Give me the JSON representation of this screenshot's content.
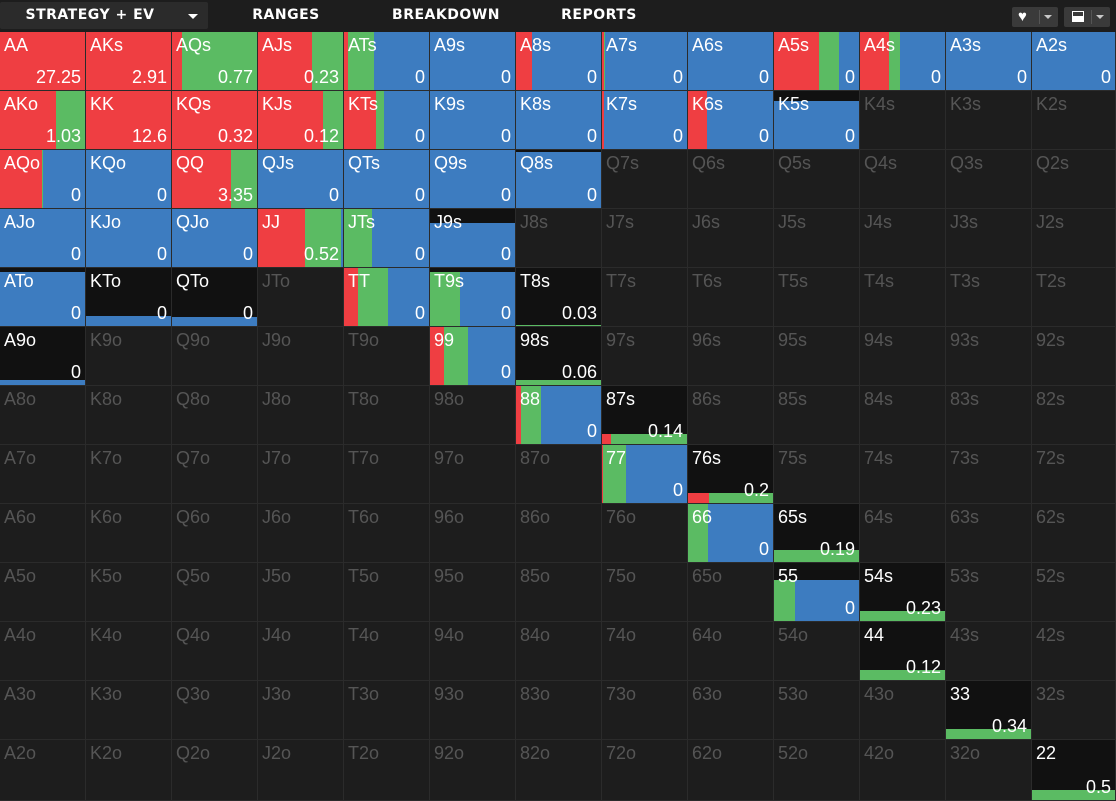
{
  "tabs": [
    {
      "label": "STRATEGY + EV",
      "active": true
    },
    {
      "label": "RANGES",
      "active": false
    },
    {
      "label": "BREAKDOWN",
      "active": false
    },
    {
      "label": "REPORTS",
      "active": false
    }
  ],
  "toolbar": {
    "heart_icon": "heart-icon",
    "layout_icon": "layout-icon"
  },
  "colors": {
    "raise": "#ef3e42",
    "call": "#5bbb63",
    "fold": "#3d7cc0",
    "background": "#1d1d1d",
    "inactive_text": "#555555"
  },
  "grid_hands": [
    [
      "AA",
      "AKs",
      "AQs",
      "AJs",
      "ATs",
      "A9s",
      "A8s",
      "A7s",
      "A6s",
      "A5s",
      "A4s",
      "A3s",
      "A2s"
    ],
    [
      "AKo",
      "KK",
      "KQs",
      "KJs",
      "KTs",
      "K9s",
      "K8s",
      "K7s",
      "K6s",
      "K5s",
      "K4s",
      "K3s",
      "K2s"
    ],
    [
      "AQo",
      "KQo",
      "QQ",
      "QJs",
      "QTs",
      "Q9s",
      "Q8s",
      "Q7s",
      "Q6s",
      "Q5s",
      "Q4s",
      "Q3s",
      "Q2s"
    ],
    [
      "AJo",
      "KJo",
      "QJo",
      "JJ",
      "JTs",
      "J9s",
      "J8s",
      "J7s",
      "J6s",
      "J5s",
      "J4s",
      "J3s",
      "J2s"
    ],
    [
      "ATo",
      "KTo",
      "QTo",
      "JTo",
      "TT",
      "T9s",
      "T8s",
      "T7s",
      "T6s",
      "T5s",
      "T4s",
      "T3s",
      "T2s"
    ],
    [
      "A9o",
      "K9o",
      "Q9o",
      "J9o",
      "T9o",
      "99",
      "98s",
      "97s",
      "96s",
      "95s",
      "94s",
      "93s",
      "92s"
    ],
    [
      "A8o",
      "K8o",
      "Q8o",
      "J8o",
      "T8o",
      "98o",
      "88",
      "87s",
      "86s",
      "85s",
      "84s",
      "83s",
      "82s"
    ],
    [
      "A7o",
      "K7o",
      "Q7o",
      "J7o",
      "T7o",
      "97o",
      "87o",
      "77",
      "76s",
      "75s",
      "74s",
      "73s",
      "72s"
    ],
    [
      "A6o",
      "K6o",
      "Q6o",
      "J6o",
      "T6o",
      "96o",
      "86o",
      "76o",
      "66",
      "65s",
      "64s",
      "63s",
      "62s"
    ],
    [
      "A5o",
      "K5o",
      "Q5o",
      "J5o",
      "T5o",
      "95o",
      "85o",
      "75o",
      "65o",
      "55",
      "54s",
      "53s",
      "52s"
    ],
    [
      "A4o",
      "K4o",
      "Q4o",
      "J4o",
      "T4o",
      "94o",
      "84o",
      "74o",
      "64o",
      "54o",
      "44",
      "43s",
      "42s"
    ],
    [
      "A3o",
      "K3o",
      "Q3o",
      "J3o",
      "T3o",
      "93o",
      "83o",
      "73o",
      "63o",
      "53o",
      "43o",
      "33",
      "32s"
    ],
    [
      "A2o",
      "K2o",
      "Q2o",
      "J2o",
      "T2o",
      "92o",
      "82o",
      "72o",
      "62o",
      "52o",
      "42o",
      "32o",
      "22"
    ]
  ],
  "active_hands": {
    "AA": {
      "ev": "27.25",
      "weight": 1,
      "raise": 1,
      "call": 0,
      "fold": 0
    },
    "AKs": {
      "ev": "2.91",
      "weight": 1,
      "raise": 1,
      "call": 0,
      "fold": 0
    },
    "AQs": {
      "ev": "0.77",
      "weight": 1,
      "raise": 0.12,
      "call": 0.88,
      "fold": 0
    },
    "AJs": {
      "ev": "0.23",
      "weight": 1,
      "raise": 0.64,
      "call": 0.36,
      "fold": 0
    },
    "ATs": {
      "ev": "0",
      "weight": 1,
      "raise": 0.05,
      "call": 0.3,
      "fold": 0.65
    },
    "A9s": {
      "ev": "0",
      "weight": 1,
      "raise": 0,
      "call": 0,
      "fold": 1
    },
    "A8s": {
      "ev": "0",
      "weight": 1,
      "raise": 0.19,
      "call": 0,
      "fold": 0.81
    },
    "A7s": {
      "ev": "0",
      "weight": 1,
      "raise": 0.02,
      "call": 0.02,
      "fold": 0.96
    },
    "A6s": {
      "ev": "0",
      "weight": 1,
      "raise": 0,
      "call": 0,
      "fold": 1
    },
    "A5s": {
      "ev": "0",
      "weight": 1,
      "raise": 0.53,
      "call": 0.23,
      "fold": 0.24
    },
    "A4s": {
      "ev": "0",
      "weight": 1,
      "raise": 0.34,
      "call": 0.13,
      "fold": 0.53
    },
    "A3s": {
      "ev": "0",
      "weight": 1,
      "raise": 0,
      "call": 0,
      "fold": 1
    },
    "A2s": {
      "ev": "0",
      "weight": 1,
      "raise": 0,
      "call": 0,
      "fold": 1
    },
    "AKo": {
      "ev": "1.03",
      "weight": 1,
      "raise": 0.66,
      "call": 0.34,
      "fold": 0
    },
    "KK": {
      "ev": "12.6",
      "weight": 1,
      "raise": 1,
      "call": 0,
      "fold": 0
    },
    "KQs": {
      "ev": "0.32",
      "weight": 1,
      "raise": 1,
      "call": 0,
      "fold": 0
    },
    "KJs": {
      "ev": "0.12",
      "weight": 1,
      "raise": 0.76,
      "call": 0.24,
      "fold": 0
    },
    "KTs": {
      "ev": "0",
      "weight": 1,
      "raise": 0.38,
      "call": 0.09,
      "fold": 0.53
    },
    "K9s": {
      "ev": "0",
      "weight": 1,
      "raise": 0,
      "call": 0,
      "fold": 1
    },
    "K8s": {
      "ev": "0",
      "weight": 1,
      "raise": 0,
      "call": 0,
      "fold": 1
    },
    "K7s": {
      "ev": "0",
      "weight": 1,
      "raise": 0.02,
      "call": 0,
      "fold": 0.98
    },
    "K6s": {
      "ev": "0",
      "weight": 1,
      "raise": 0.22,
      "call": 0,
      "fold": 0.78
    },
    "K5s": {
      "ev": "0",
      "weight": 0.82,
      "raise": 0,
      "call": 0,
      "fold": 1
    },
    "AQo": {
      "ev": "0",
      "weight": 1,
      "raise": 0.49,
      "call": 0.02,
      "fold": 0.49
    },
    "KQo": {
      "ev": "0",
      "weight": 1,
      "raise": 0,
      "call": 0,
      "fold": 1
    },
    "QQ": {
      "ev": "3.35",
      "weight": 1,
      "raise": 0.69,
      "call": 0.31,
      "fold": 0
    },
    "QJs": {
      "ev": "0",
      "weight": 1,
      "raise": 0,
      "call": 0,
      "fold": 1
    },
    "QTs": {
      "ev": "0",
      "weight": 1,
      "raise": 0,
      "call": 0,
      "fold": 1
    },
    "Q9s": {
      "ev": "0",
      "weight": 1,
      "raise": 0,
      "call": 0,
      "fold": 1
    },
    "Q8s": {
      "ev": "0",
      "weight": 0.97,
      "raise": 0,
      "call": 0,
      "fold": 1
    },
    "AJo": {
      "ev": "0",
      "weight": 1,
      "raise": 0,
      "call": 0,
      "fold": 1
    },
    "KJo": {
      "ev": "0",
      "weight": 1,
      "raise": 0,
      "call": 0,
      "fold": 1
    },
    "QJo": {
      "ev": "0",
      "weight": 1,
      "raise": 0,
      "call": 0,
      "fold": 1
    },
    "JJ": {
      "ev": "0.52",
      "weight": 1,
      "raise": 0.55,
      "call": 0.43,
      "fold": 0.02
    },
    "JTs": {
      "ev": "0",
      "weight": 1,
      "raise": 0,
      "call": 0.33,
      "fold": 0.67
    },
    "J9s": {
      "ev": "0",
      "weight": 0.76,
      "raise": 0,
      "call": 0,
      "fold": 1
    },
    "ATo": {
      "ev": "0",
      "weight": 0.93,
      "raise": 0,
      "call": 0,
      "fold": 1
    },
    "KTo": {
      "ev": "0",
      "weight": 0.17,
      "raise": 0,
      "call": 0,
      "fold": 1
    },
    "QTo": {
      "ev": "0",
      "weight": 0.16,
      "raise": 0,
      "call": 0,
      "fold": 1
    },
    "TT": {
      "ev": "0",
      "weight": 1,
      "raise": 0.17,
      "call": 0.35,
      "fold": 0.48
    },
    "T9s": {
      "ev": "0",
      "weight": 0.93,
      "raise": 0,
      "call": 0.35,
      "fold": 0.65
    },
    "T8s": {
      "ev": "0.03",
      "weight": 0.02,
      "raise": 0,
      "call": 1,
      "fold": 0
    },
    "A9o": {
      "ev": "0",
      "weight": 0.09,
      "raise": 0,
      "call": 0,
      "fold": 1
    },
    "99": {
      "ev": "0",
      "weight": 1,
      "raise": 0.16,
      "call": 0.29,
      "fold": 0.55
    },
    "98s": {
      "ev": "0.06",
      "weight": 0.09,
      "raise": 0,
      "call": 1,
      "fold": 0
    },
    "88": {
      "ev": "0",
      "weight": 1,
      "raise": 0.06,
      "call": 0.24,
      "fold": 0.7
    },
    "87s": {
      "ev": "0.14",
      "weight": 0.17,
      "raise": 0.1,
      "call": 0.9,
      "fold": 0
    },
    "77": {
      "ev": "0",
      "weight": 1,
      "raise": 0.01,
      "call": 0.27,
      "fold": 0.72
    },
    "76s": {
      "ev": "0.2",
      "weight": 0.17,
      "raise": 0.25,
      "call": 0.75,
      "fold": 0
    },
    "66": {
      "ev": "0",
      "weight": 1,
      "raise": 0,
      "call": 0.23,
      "fold": 0.77
    },
    "65s": {
      "ev": "0.19",
      "weight": 0.2,
      "raise": 0,
      "call": 1,
      "fold": 0
    },
    "55": {
      "ev": "0",
      "weight": 0.7,
      "raise": 0,
      "call": 0.25,
      "fold": 0.75
    },
    "54s": {
      "ev": "0.23",
      "weight": 0.17,
      "raise": 0,
      "call": 1,
      "fold": 0
    },
    "44": {
      "ev": "0.12",
      "weight": 0.17,
      "raise": 0,
      "call": 1,
      "fold": 0
    },
    "33": {
      "ev": "0.34",
      "weight": 0.17,
      "raise": 0,
      "call": 1,
      "fold": 0
    },
    "22": {
      "ev": "0.5",
      "weight": 0.17,
      "raise": 0,
      "call": 1,
      "fold": 0
    }
  }
}
